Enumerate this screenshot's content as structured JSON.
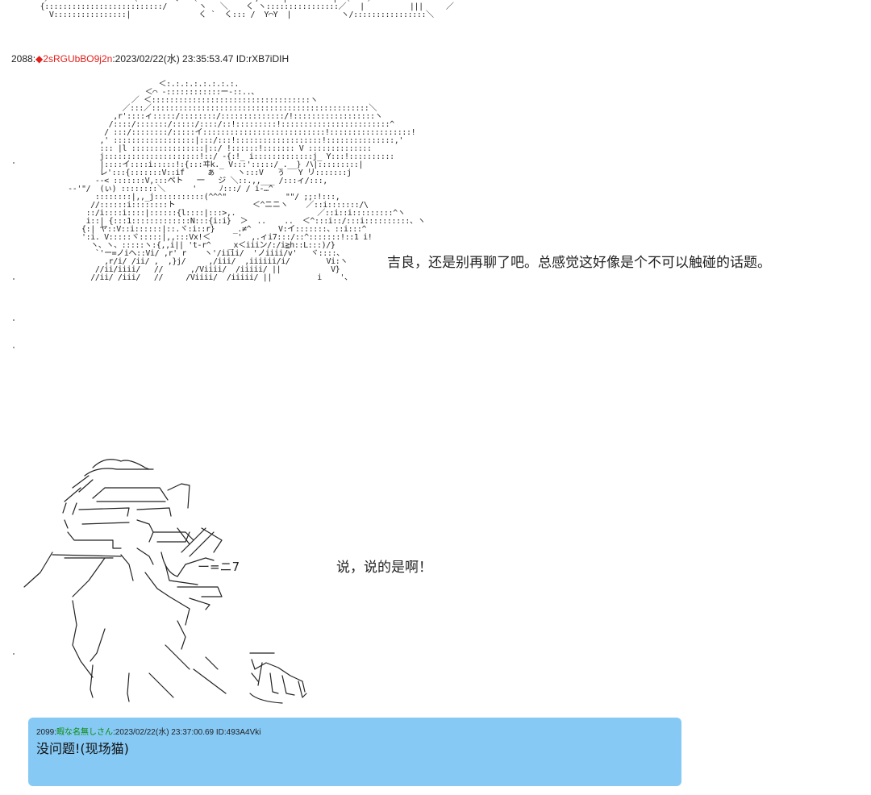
{
  "post": {
    "number": "2088",
    "separator": ":",
    "trip_mark": "◆2sRGUbBO9j2n",
    "after_trip": ":",
    "datetime": "2023/02/22(水) 23:35:53.47",
    "id": "ID:rXB7iDIH"
  },
  "dialogue": {
    "line1": "吉良，还是别再聊了吧。总感觉这好像是个不可以触碰的话题。",
    "line2": "说，说的是啊！",
    "line2_sfx": "ー=ニ7"
  },
  "reply": {
    "number": "2099",
    "separator": ":",
    "name": "暇な名無しさん",
    "meta": ":2023/02/22(水) 23:37:00.69 ID:493A4Vki",
    "body": "没问题!(现场猫)"
  },
  "colors": {
    "trip": "#e0201c",
    "reply_name": "#0a8a0a",
    "reply_background": "#86c9f5"
  }
}
